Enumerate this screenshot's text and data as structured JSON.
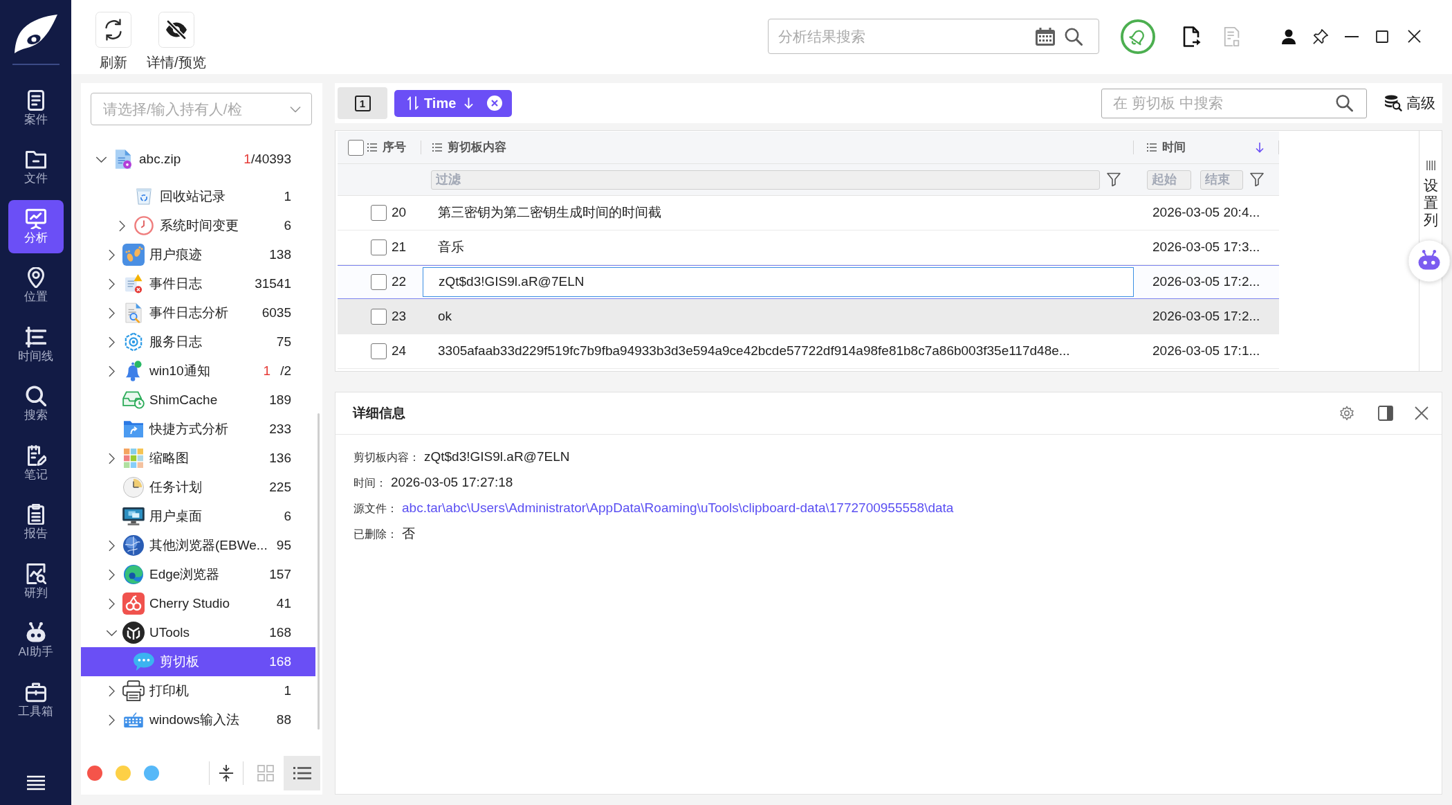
{
  "nav": {
    "items": [
      {
        "label": "案件",
        "selected": false
      },
      {
        "label": "文件",
        "selected": false
      },
      {
        "label": "分析",
        "selected": true
      },
      {
        "label": "位置",
        "selected": false
      },
      {
        "label": "时间线",
        "selected": false
      },
      {
        "label": "搜索",
        "selected": false
      },
      {
        "label": "笔记",
        "selected": false
      },
      {
        "label": "报告",
        "selected": false
      },
      {
        "label": "研判",
        "selected": false
      },
      {
        "label": "AI助手",
        "selected": false
      },
      {
        "label": "工具箱",
        "selected": false
      }
    ]
  },
  "toolbar": {
    "buttons": [
      {
        "label": "刷新"
      },
      {
        "label": "详情/预览"
      }
    ]
  },
  "result_search": {
    "placeholder": "分析结果搜索"
  },
  "export_buttons": [
    {
      "disabled": false
    },
    {
      "disabled": true
    }
  ],
  "owner_select": {
    "placeholder": "请选择/输入持有人/检"
  },
  "tree": [
    {
      "kind": "source",
      "label": "abc.zip",
      "alert_count": "1",
      "count": "/40393",
      "expandable": true,
      "expanded": true,
      "selected": false,
      "children": [
        {
          "label": "回收站记录",
          "count": "1",
          "expandable": false,
          "selected": false
        },
        {
          "label": "系统时间变更",
          "count": "6",
          "expandable": true,
          "expanded": false,
          "selected": false
        }
      ]
    },
    {
      "kind": "category",
      "label": "用户痕迹",
      "count": "138",
      "expandable": true,
      "expanded": false,
      "selected": false
    },
    {
      "kind": "category",
      "label": "事件日志",
      "count": "31541",
      "expandable": true,
      "expanded": false,
      "selected": false
    },
    {
      "kind": "category",
      "label": "事件日志分析",
      "count": "6035",
      "expandable": true,
      "expanded": false,
      "selected": false
    },
    {
      "kind": "category",
      "label": "服务日志",
      "count": "75",
      "expandable": true,
      "expanded": false,
      "selected": false
    },
    {
      "kind": "category",
      "label": "win10通知",
      "alert_count": "1",
      "count": "/2",
      "expandable": true,
      "expanded": false,
      "selected": false
    },
    {
      "kind": "category",
      "label": "ShimCache",
      "count": "189",
      "expandable": false,
      "selected": false
    },
    {
      "kind": "category",
      "label": "快捷方式分析",
      "count": "233",
      "expandable": false,
      "selected": false
    },
    {
      "kind": "category",
      "label": "缩略图",
      "count": "136",
      "expandable": true,
      "expanded": false,
      "selected": false
    },
    {
      "kind": "category",
      "label": "任务计划",
      "count": "225",
      "expandable": false,
      "selected": false
    },
    {
      "kind": "category",
      "label": "用户桌面",
      "count": "6",
      "expandable": false,
      "selected": false
    },
    {
      "kind": "category",
      "label": "其他浏览器(EBWe...",
      "count": "95",
      "expandable": true,
      "expanded": false,
      "selected": false
    },
    {
      "kind": "category",
      "label": "Edge浏览器",
      "count": "157",
      "expandable": true,
      "expanded": false,
      "selected": false
    },
    {
      "kind": "category",
      "label": "Cherry Studio",
      "count": "41",
      "expandable": true,
      "expanded": false,
      "selected": false
    },
    {
      "kind": "category",
      "label": "UTools",
      "count": "168",
      "expandable": true,
      "expanded": true,
      "selected": false,
      "children": [
        {
          "label": "剪切板",
          "count": "168",
          "expandable": false,
          "selected": true
        }
      ]
    },
    {
      "kind": "category",
      "label": "打印机",
      "count": "1",
      "expandable": true,
      "expanded": false,
      "selected": false
    },
    {
      "kind": "category",
      "label": "windows输入法",
      "count": "88",
      "expandable": true,
      "expanded": false,
      "selected": false
    }
  ],
  "color_dots": [
    {
      "color": "#f5544a"
    },
    {
      "color": "#fdd046"
    },
    {
      "color": "#56b8f8"
    }
  ],
  "view_modes": [
    {
      "selected": false
    },
    {
      "selected": true
    }
  ],
  "list_toolbar": {
    "view_button": "1",
    "sort_chip": {
      "label": "Time",
      "descending": true
    },
    "search": {
      "placeholder": "在 剪切板 中搜索"
    },
    "advanced_button": "高级"
  },
  "table": {
    "all_checked": false,
    "columns": [
      {
        "label": "序号",
        "sorted": false
      },
      {
        "label": "剪切板内容",
        "sorted": false
      },
      {
        "label": "时间",
        "sorted": true
      }
    ],
    "filter": {
      "placeholder": "过滤",
      "start_placeholder": "起始",
      "end_placeholder": "结束"
    },
    "rows": [
      {
        "number": "20",
        "content": "第三密钥为第二密钥生成时间的时间截",
        "time": "2026-03-05 20:4...",
        "checked": false,
        "selected": false,
        "hovered": false
      },
      {
        "number": "21",
        "content": "音乐",
        "time": "2026-03-05 17:3...",
        "checked": false,
        "selected": false,
        "hovered": false
      },
      {
        "number": "22",
        "content": "zQt$d3!GIS9l.aR@7ELN",
        "time": "2026-03-05 17:2...",
        "checked": false,
        "selected": true,
        "hovered": false
      },
      {
        "number": "23",
        "content": "ok",
        "time": "2026-03-05 17:2...",
        "checked": false,
        "selected": false,
        "hovered": true
      },
      {
        "number": "24",
        "content": "3305afaab33d229f519fc7b9fba94933b3d3e594a9ce42bcde57722df914a98fe81b8c7a86b003f35e117d48e...",
        "time": "2026-03-05 17:1...",
        "checked": false,
        "selected": false,
        "hovered": false
      }
    ]
  },
  "column_settings": {
    "label": "设置列"
  },
  "details": {
    "title": "详细信息",
    "fields": [
      {
        "kind": "text",
        "label": "剪切板内容：",
        "value": "zQt$d3!GIS9l.aR@7ELN"
      },
      {
        "kind": "text",
        "label": "时间：",
        "value": "2026-03-05 17:27:18"
      },
      {
        "kind": "link",
        "label": "源文件：",
        "value": "abc.tar\\abc\\Users\\Administrator\\AppData\\Roaming\\uTools\\clipboard-data\\1772700955558\\data"
      },
      {
        "kind": "text",
        "label": "已删除：",
        "value": "否"
      }
    ]
  }
}
